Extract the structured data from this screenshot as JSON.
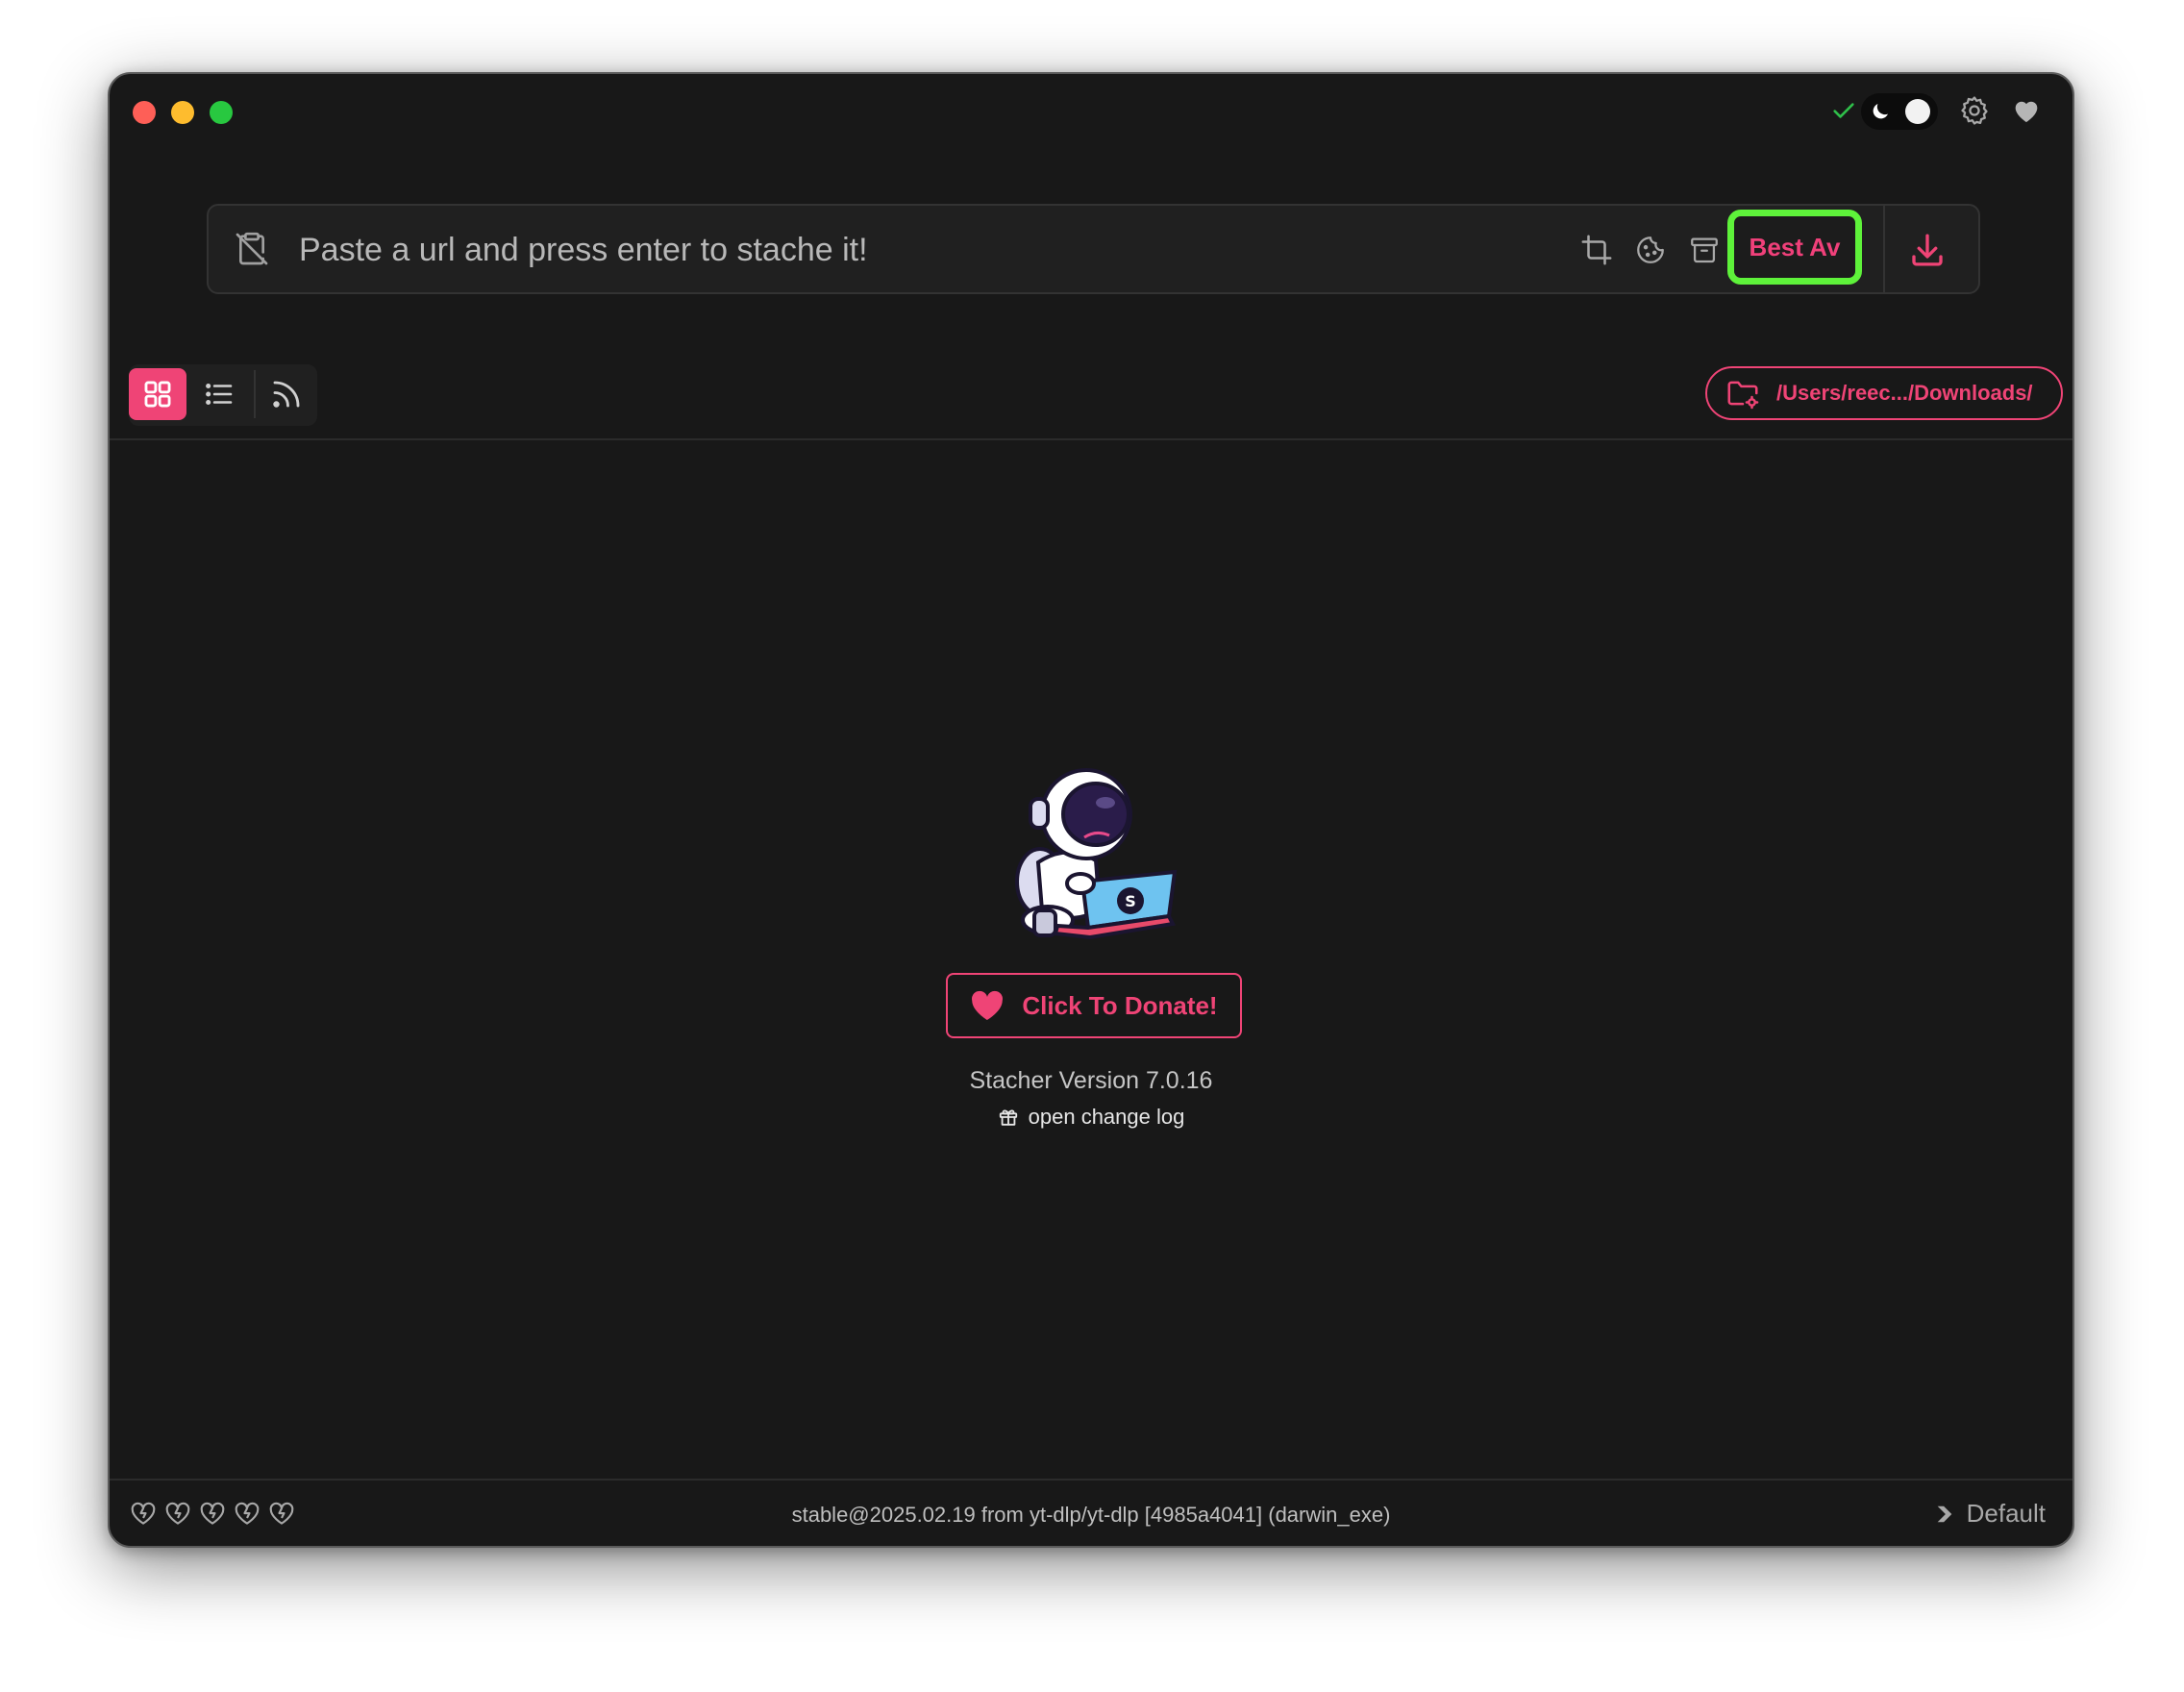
{
  "window": {
    "traffic_lights": [
      "close",
      "minimize",
      "maximize"
    ]
  },
  "toolbar_icons": {
    "status": "check-icon",
    "theme_dark": "moon-icon",
    "theme_light": "sun-icon",
    "settings": "gear-icon",
    "favorite": "heart-icon"
  },
  "url_bar": {
    "placeholder": "Paste a url and press enter to stache it!",
    "value": "",
    "format_label": "Best Av",
    "icons": [
      "clipboard-off-icon",
      "crop-icon",
      "cookie-icon",
      "archive-icon",
      "download-icon"
    ]
  },
  "view_tabs": [
    {
      "name": "grid",
      "icon": "grid-icon",
      "active": true
    },
    {
      "name": "list",
      "icon": "list-icon",
      "active": false
    },
    {
      "name": "feed",
      "icon": "rss-icon",
      "active": false
    }
  ],
  "download_folder": {
    "label": "/Users/reec.../Downloads/",
    "icon": "folder-settings-icon"
  },
  "main": {
    "donate_label": "Click To Donate!",
    "version_text": "Stacher Version 7.0.16",
    "changelog_label": "open change log"
  },
  "footer": {
    "hearts_count": 5,
    "status_text": "stable@2025.02.19 from yt-dlp/yt-dlp [4985a4041] (darwin_exe)",
    "profile_label": "Default"
  },
  "colors": {
    "accent": "#ef4476",
    "highlight": "#5ef23a",
    "background": "#181818",
    "status_ok": "#2fbf4a"
  }
}
